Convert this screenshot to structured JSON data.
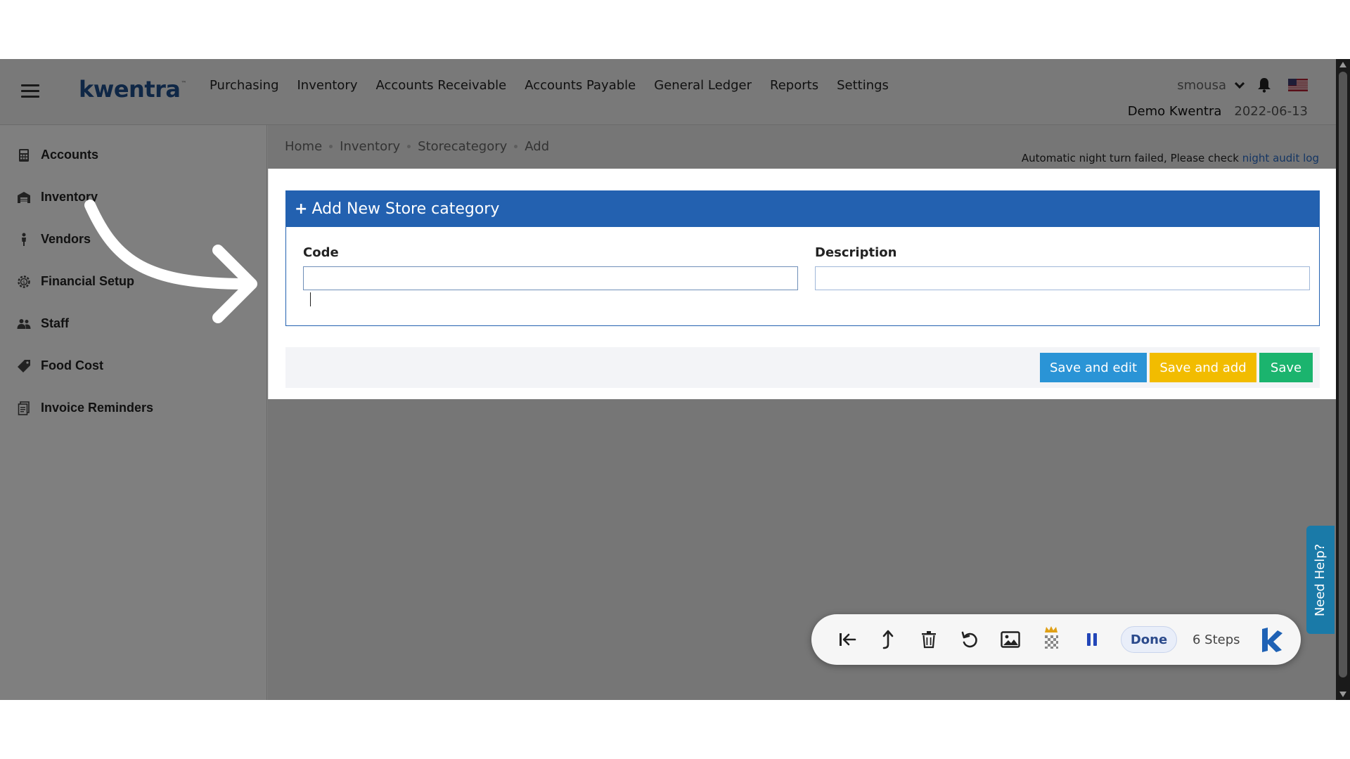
{
  "header": {
    "logo": "kwentra",
    "logo_tm": "™",
    "nav": [
      "Purchasing",
      "Inventory",
      "Accounts Receivable",
      "Accounts Payable",
      "General Ledger",
      "Reports",
      "Settings"
    ],
    "username": "smousa",
    "company": "Demo Kwentra",
    "date": "2022-06-13"
  },
  "sidebar": {
    "items": [
      {
        "label": "Accounts",
        "icon": "calculator-icon"
      },
      {
        "label": "Inventory",
        "icon": "warehouse-icon"
      },
      {
        "label": "Vendors",
        "icon": "person-icon"
      },
      {
        "label": "Financial Setup",
        "icon": "gear-icon"
      },
      {
        "label": "Staff",
        "icon": "users-icon"
      },
      {
        "label": "Food Cost",
        "icon": "tag-icon"
      },
      {
        "label": "Invoice Reminders",
        "icon": "document-icon"
      }
    ]
  },
  "breadcrumb": [
    "Home",
    "Inventory",
    "Storecategory",
    "Add"
  ],
  "notice": {
    "text": "Automatic night turn failed, Please check ",
    "link": "night audit log"
  },
  "form": {
    "title": "Add New Store category",
    "code_label": "Code",
    "code_value": "",
    "description_label": "Description",
    "description_value": ""
  },
  "buttons": {
    "save_and_edit": "Save and edit",
    "save_and_add": "Save and add",
    "save": "Save"
  },
  "need_help": "Need Help?",
  "recorder": {
    "done": "Done",
    "steps": "6 Steps"
  },
  "colors": {
    "brand": "#1f4e8c",
    "panel_header": "#2361b0",
    "save_edit": "#2a94d6",
    "save_add": "#f2bc00",
    "save": "#1bb46e",
    "help_tab": "#1a7aa8"
  }
}
